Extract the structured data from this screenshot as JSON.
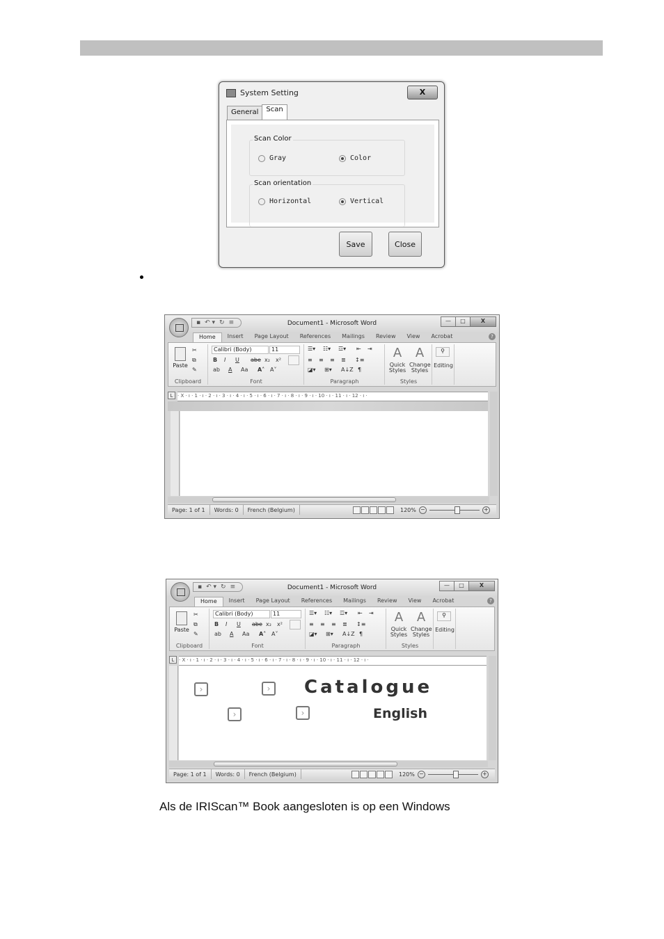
{
  "dialog": {
    "title": "System Setting",
    "close_glyph": "X",
    "tabs": [
      {
        "label": "General",
        "active": false
      },
      {
        "label": "Scan",
        "active": true
      }
    ],
    "groups": [
      {
        "label": "Scan Color",
        "options": [
          {
            "label": "Gray",
            "selected": false
          },
          {
            "label": "Color",
            "selected": true
          }
        ]
      },
      {
        "label": "Scan orientation",
        "options": [
          {
            "label": "Horizontal",
            "selected": false
          },
          {
            "label": "Vertical",
            "selected": true
          }
        ]
      }
    ],
    "buttons": {
      "save": "Save",
      "close": "Close"
    }
  },
  "word": {
    "title": "Document1 - Microsoft Word",
    "qat": {
      "save": "▪",
      "undo": "↶ ▾",
      "redo": "↻",
      "customize": "≡"
    },
    "window_controls": {
      "minimize": "—",
      "maximize": "□",
      "close": "X"
    },
    "tabs": [
      "Home",
      "Insert",
      "Page Layout",
      "References",
      "Mailings",
      "Review",
      "View",
      "Acrobat"
    ],
    "help": "?",
    "ribbon": {
      "clipboard": {
        "label": "Clipboard",
        "paste": "Paste"
      },
      "font": {
        "label": "Font",
        "name": "Calibri (Body)",
        "size": "11",
        "bold": "B",
        "italic": "I",
        "underline": "U",
        "strike": "abe",
        "sub": "x₂",
        "sup": "x²",
        "grow": "A˄",
        "shrink": "A˅",
        "case": "Aa",
        "color": "A",
        "highlight": "ab"
      },
      "paragraph": {
        "label": "Paragraph",
        "sort": "A↓Z",
        "pilcrow": "¶"
      },
      "styles": {
        "label": "Styles",
        "quick": "Quick Styles",
        "change": "Change Styles"
      },
      "editing": {
        "label": "Editing"
      }
    },
    "ruler": "· X · ı · 1 · ı · 2 · ı · 3 · ı · 4 · ı · 5 · ı · 6 · ı · 7 · ı · 8 · ı · 9 · ı · 10 · ı · 11 · ı · 12 · ı ·",
    "ruler_corner": "L",
    "status": {
      "page": "Page: 1 of 1",
      "words": "Words: 0",
      "language": "French (Belgium)",
      "zoom": "120%"
    },
    "zoom_percent": 120
  },
  "word2_content": {
    "title_text": "Catalogue",
    "subtitle_text": "English",
    "chevron_glyph": "›"
  },
  "caption": "Als de IRIScan™ Book aangesloten is op een Windows"
}
